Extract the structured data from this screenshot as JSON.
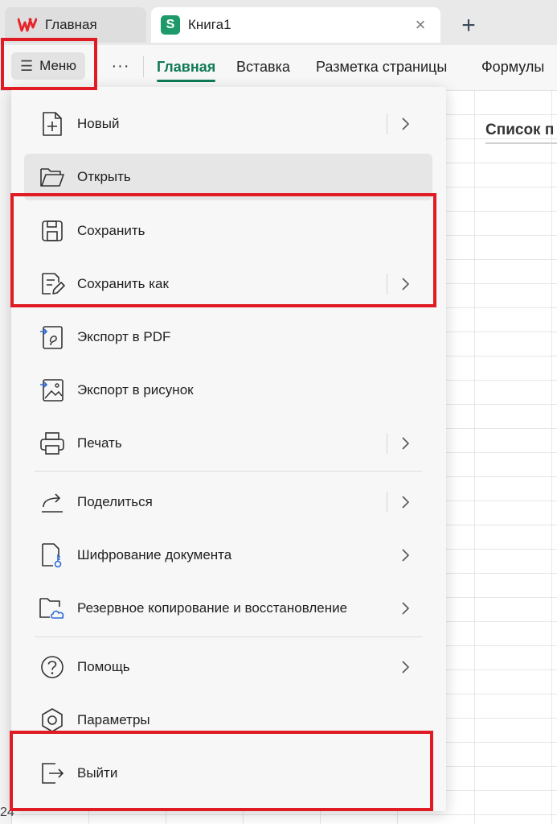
{
  "tabs": {
    "home_label": "Главная",
    "doc_label": "Книга1",
    "doc_logo_letter": "S",
    "close_glyph": "×",
    "new_tab_glyph": "+"
  },
  "ribbon": {
    "menu_label": "Меню",
    "more_glyph": "···",
    "tabs": [
      "Главная",
      "Вставка",
      "Разметка страницы",
      "Формулы"
    ],
    "active_tab": "Главная"
  },
  "sheet": {
    "cell_text": "Список п",
    "row_number": "24"
  },
  "menu": {
    "items": [
      {
        "label": "Новый",
        "icon": "new-document-icon",
        "submenu": true
      },
      {
        "label": "Открыть",
        "icon": "folder-open-icon",
        "submenu": false
      },
      {
        "label": "Сохранить",
        "icon": "save-icon",
        "submenu": false
      },
      {
        "label": "Сохранить как",
        "icon": "save-as-icon",
        "submenu": true
      },
      {
        "label": "Экспорт в PDF",
        "icon": "export-pdf-icon",
        "submenu": false
      },
      {
        "label": "Экспорт в рисунок",
        "icon": "export-image-icon",
        "submenu": false
      },
      {
        "label": "Печать",
        "icon": "printer-icon",
        "submenu": true
      },
      {
        "label": "Поделиться",
        "icon": "share-icon",
        "submenu": true
      },
      {
        "label": "Шифрование документа",
        "icon": "encrypt-document-icon",
        "submenu": true
      },
      {
        "label": "Резервное копирование и восстановление",
        "icon": "backup-cloud-icon",
        "submenu": true
      },
      {
        "label": "Помощь",
        "icon": "help-icon",
        "submenu": true
      },
      {
        "label": "Параметры",
        "icon": "settings-icon",
        "submenu": false
      },
      {
        "label": "Выйти",
        "icon": "exit-icon",
        "submenu": false
      }
    ],
    "hovered_item": "Открыть"
  },
  "colors": {
    "accent": "#0f7a55",
    "highlight": "#e01b24",
    "wps_red": "#e8242a",
    "sheets_green": "#1e9a6a"
  }
}
